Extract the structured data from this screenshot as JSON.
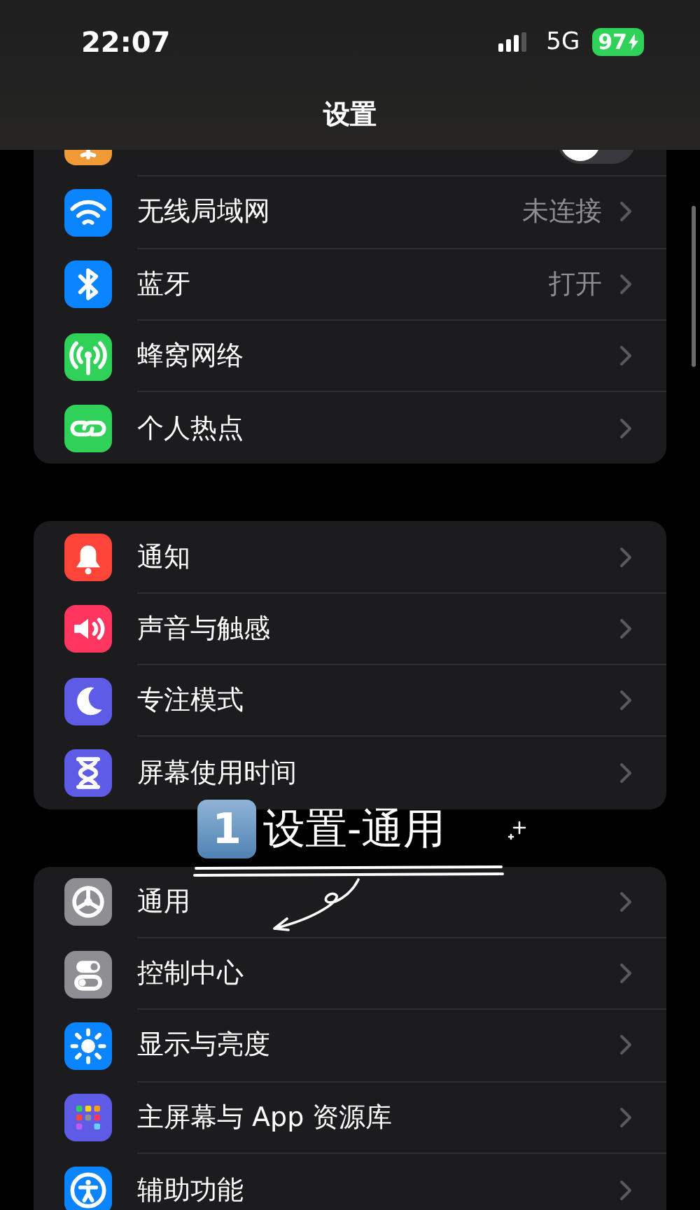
{
  "status_bar": {
    "time": "22:07",
    "network": "5G",
    "battery": "97",
    "charging": true
  },
  "title": "设置",
  "groups": [
    {
      "rows": [
        {
          "kind": "toggle",
          "on": false
        },
        {
          "kind": "link",
          "label": "无线局域网",
          "value": "未连接"
        },
        {
          "kind": "link",
          "label": "蓝牙",
          "value": "打开"
        },
        {
          "kind": "link",
          "label": "蜂窝网络"
        },
        {
          "kind": "link",
          "label": "个人热点"
        }
      ]
    },
    {
      "rows": [
        {
          "kind": "link",
          "label": "通知"
        },
        {
          "kind": "link",
          "label": "声音与触感"
        },
        {
          "kind": "link",
          "label": "专注模式"
        },
        {
          "kind": "link",
          "label": "屏幕使用时间"
        }
      ]
    },
    {
      "rows": [
        {
          "kind": "link",
          "label": "通用"
        },
        {
          "kind": "link",
          "label": "控制中心"
        },
        {
          "kind": "link",
          "label": "显示与亮度"
        },
        {
          "kind": "link",
          "label": "主屏幕与 App 资源库"
        },
        {
          "kind": "link",
          "label": "辅助功能"
        }
      ]
    }
  ],
  "annotation": {
    "badge": "1",
    "text": "设置-通用"
  }
}
